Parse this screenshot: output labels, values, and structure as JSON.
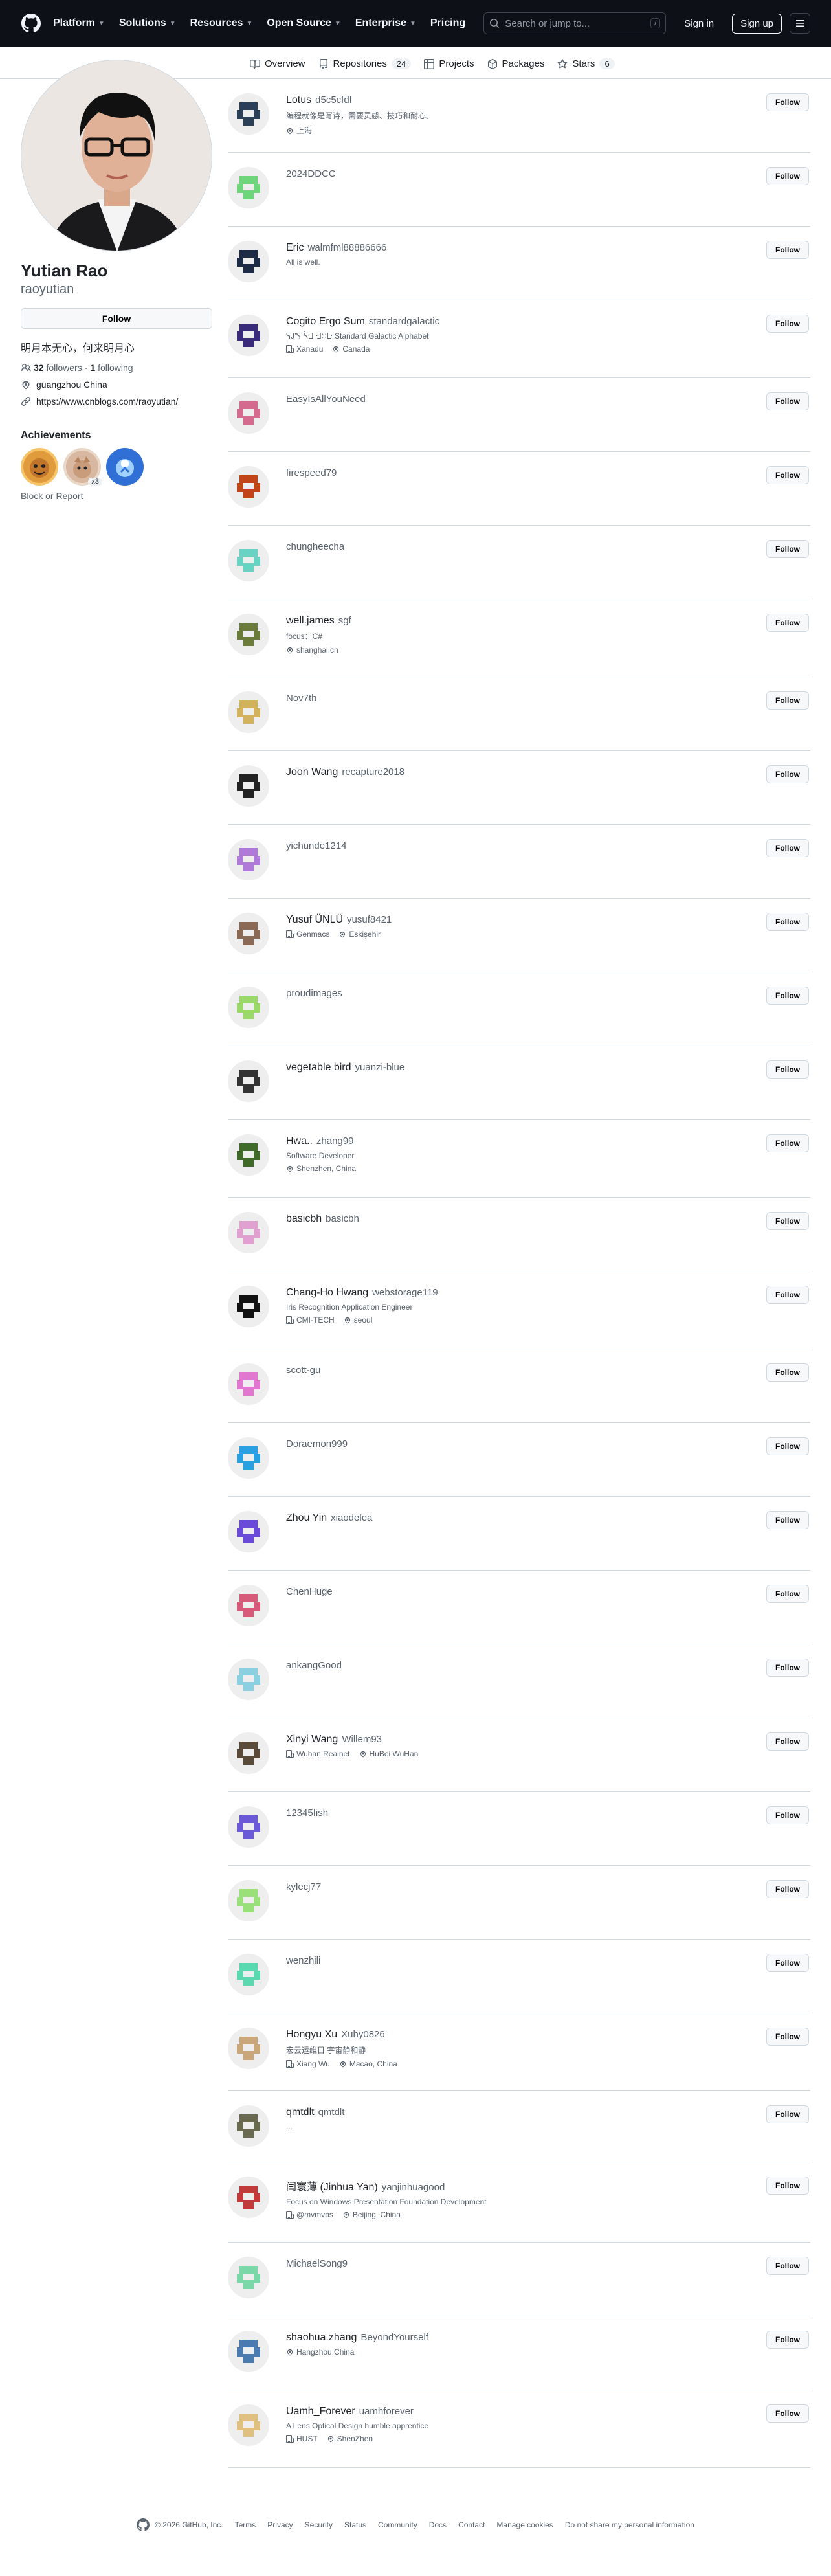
{
  "header": {
    "nav": [
      "Platform",
      "Solutions",
      "Resources",
      "Open Source",
      "Enterprise",
      "Pricing"
    ],
    "search_placeholder": "Search or jump to...",
    "search_key": "/",
    "sign_in": "Sign in",
    "sign_up": "Sign up"
  },
  "tabs": [
    {
      "label": "Overview",
      "count": ""
    },
    {
      "label": "Repositories",
      "count": "24"
    },
    {
      "label": "Projects",
      "count": ""
    },
    {
      "label": "Packages",
      "count": ""
    },
    {
      "label": "Stars",
      "count": "6"
    }
  ],
  "profile": {
    "name": "Yutian Rao",
    "login": "raoyutian",
    "follow_label": "Follow",
    "bio": "明月本无心，何来明月心",
    "followers_count": "32",
    "followers_label": "followers",
    "following_count": "1",
    "following_label": "following",
    "location": "guangzhou China",
    "website": "https://www.cnblogs.com/raoyutian/",
    "achievements_title": "Achievements",
    "badge_multiplier": "x3",
    "block_report": "Block or Report"
  },
  "colors": {
    "header_bg": "#0d1117",
    "border": "#d1d9e0",
    "muted_text": "#59636e"
  },
  "followers": [
    {
      "name": "Lotus",
      "login": "d5c5cfdf",
      "bio": "编程就像是写诗，需要灵感、技巧和耐心。",
      "company": "",
      "location": "上海",
      "button": "Follow"
    },
    {
      "name": "",
      "login": "2024DDCC",
      "bio": "",
      "company": "",
      "location": "",
      "button": "Follow"
    },
    {
      "name": "Eric",
      "login": "walmfml88886666",
      "bio": "All is well.",
      "company": "",
      "location": "",
      "button": "Follow"
    },
    {
      "name": "Cogito Ergo Sum",
      "login": "standardgalactic",
      "bio": "ᓭᔑᓭ ᓵᒲ ᒲ∷ᒷ Standard Galactic Alphabet",
      "company": "Xanadu",
      "location": "Canada",
      "button": "Follow"
    },
    {
      "name": "",
      "login": "EasyIsAllYouNeed",
      "bio": "",
      "company": "",
      "location": "",
      "button": "Follow"
    },
    {
      "name": "",
      "login": "firespeed79",
      "bio": "",
      "company": "",
      "location": "",
      "button": "Follow"
    },
    {
      "name": "",
      "login": "chungheecha",
      "bio": "",
      "company": "",
      "location": "",
      "button": "Follow"
    },
    {
      "name": "well.james",
      "login": "sgf",
      "bio": "focus：C#",
      "company": "",
      "location": "shanghai.cn",
      "button": "Follow"
    },
    {
      "name": "",
      "login": "Nov7th",
      "bio": "",
      "company": "",
      "location": "",
      "button": "Follow"
    },
    {
      "name": "Joon Wang",
      "login": "recapture2018",
      "bio": "",
      "company": "",
      "location": "",
      "button": "Follow"
    },
    {
      "name": "",
      "login": "yichunde1214",
      "bio": "",
      "company": "",
      "location": "",
      "button": "Follow"
    },
    {
      "name": "Yusuf ÜNLÜ",
      "login": "yusuf8421",
      "bio": "",
      "company": "Genmacs",
      "location": "Eskişehir",
      "button": "Follow"
    },
    {
      "name": "",
      "login": "proudimages",
      "bio": "",
      "company": "",
      "location": "",
      "button": "Follow"
    },
    {
      "name": "vegetable bird",
      "login": "yuanzi-blue",
      "bio": "",
      "company": "",
      "location": "",
      "button": "Follow"
    },
    {
      "name": "Hwa..",
      "login": "zhang99",
      "bio": "Software Developer",
      "company": "",
      "location": "Shenzhen, China",
      "button": "Follow"
    },
    {
      "name": "basicbh",
      "login": "basicbh",
      "bio": "",
      "company": "",
      "location": "",
      "button": "Follow"
    },
    {
      "name": "Chang-Ho Hwang",
      "login": "webstorage119",
      "bio": "Iris Recognition Application Engineer",
      "company": "CMI-TECH",
      "location": "seoul",
      "button": "Follow"
    },
    {
      "name": "",
      "login": "scott-gu",
      "bio": "",
      "company": "",
      "location": "",
      "button": "Follow"
    },
    {
      "name": "",
      "login": "Doraemon999",
      "bio": "",
      "company": "",
      "location": "",
      "button": "Follow"
    },
    {
      "name": "Zhou Yin",
      "login": "xiaodelea",
      "bio": "",
      "company": "",
      "location": "",
      "button": "Follow"
    },
    {
      "name": "",
      "login": "ChenHuge",
      "bio": "",
      "company": "",
      "location": "",
      "button": "Follow"
    },
    {
      "name": "",
      "login": "ankangGood",
      "bio": "",
      "company": "",
      "location": "",
      "button": "Follow"
    },
    {
      "name": "Xinyi Wang",
      "login": "Willem93",
      "bio": "",
      "company": "Wuhan Realnet",
      "location": "HuBei WuHan",
      "button": "Follow"
    },
    {
      "name": "",
      "login": "12345fish",
      "bio": "",
      "company": "",
      "location": "",
      "button": "Follow"
    },
    {
      "name": "",
      "login": "kylecj77",
      "bio": "",
      "company": "",
      "location": "",
      "button": "Follow"
    },
    {
      "name": "",
      "login": "wenzhili",
      "bio": "",
      "company": "",
      "location": "",
      "button": "Follow"
    },
    {
      "name": "Hongyu Xu",
      "login": "Xuhy0826",
      "bio": "宏云运维日 宇宙静和静",
      "company": "Xiang Wu",
      "location": "Macao, China",
      "button": "Follow"
    },
    {
      "name": "qmtdlt",
      "login": "qmtdlt",
      "bio": "...",
      "company": "",
      "location": "",
      "button": "Follow"
    },
    {
      "name": "闫寰薄 (Jinhua Yan)",
      "login": "yanjinhuagood",
      "bio": "Focus on Windows Presentation Foundation Development",
      "company": "@mvmvps",
      "location": "Beijing, China",
      "button": "Follow"
    },
    {
      "name": "",
      "login": "MichaelSong9",
      "bio": "",
      "company": "",
      "location": "",
      "button": "Follow"
    },
    {
      "name": "shaohua.zhang",
      "login": "BeyondYourself",
      "bio": "",
      "company": "",
      "location": "Hangzhou China",
      "button": "Follow"
    },
    {
      "name": "Uamh_Forever",
      "login": "uamhforever",
      "bio": "A Lens Optical Design humble apprentice",
      "company": "HUST",
      "location": "ShenZhen",
      "button": "Follow"
    }
  ],
  "footer": {
    "copyright": "© 2026 GitHub, Inc.",
    "links": [
      "Terms",
      "Privacy",
      "Security",
      "Status",
      "Community",
      "Docs",
      "Contact",
      "Manage cookies",
      "Do not share my personal information"
    ]
  }
}
